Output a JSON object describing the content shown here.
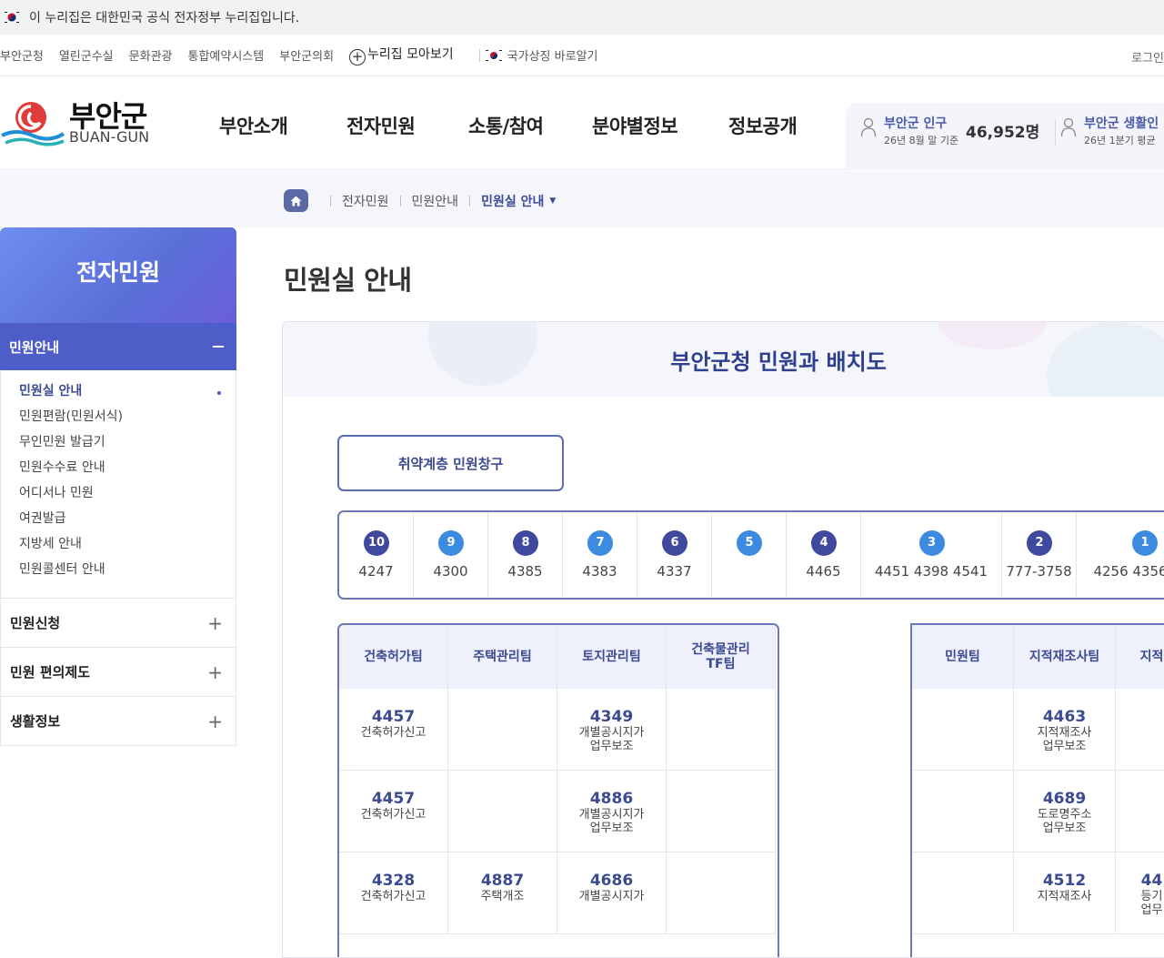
{
  "gov_banner": {
    "text": "이 누리집은 대한민국 공식 전자정부 누리집입니다."
  },
  "util_links": [
    "부안군청",
    "열린군수실",
    "문화관광",
    "통합예약시스템",
    "부안군의회"
  ],
  "util_gather": "누리집 모아보기",
  "util_symbol": "국가상징 바로알기",
  "util_login": "로그인",
  "logo": {
    "name": "부안군",
    "en": "BUAN-GUN"
  },
  "gnb": [
    "부안소개",
    "전자민원",
    "소통/참여",
    "분야별정보",
    "정보공개"
  ],
  "stats": [
    {
      "title": "부안군 인구",
      "sub": "26년 8월 말 기준",
      "value": "46,952명"
    },
    {
      "title": "부안군 생활인",
      "sub": "26년 1분기 평균",
      "value": ""
    }
  ],
  "breadcrumb": [
    "전자민원",
    "민원안내",
    "민원실 안내"
  ],
  "sidebar": {
    "title": "전자민원",
    "open_section": "민원안내",
    "sub_items": [
      "민원실 안내",
      "민원편람(민원서식)",
      "무인민원 발급기",
      "민원수수료 안내",
      "어디서나 민원",
      "여권발급",
      "지방세 안내",
      "민원콜센터 안내"
    ],
    "sections": [
      "민원신청",
      "민원 편의제도",
      "생활정보"
    ]
  },
  "page_title": "민원실 안내",
  "map_title": "부안군청 민원과 배치도",
  "weak_window_button": "취약계층 민원창구",
  "windows": [
    {
      "no": "10",
      "nums": "4247"
    },
    {
      "no": "9",
      "nums": "4300"
    },
    {
      "no": "8",
      "nums": "4385"
    },
    {
      "no": "7",
      "nums": "4383"
    },
    {
      "no": "6",
      "nums": "4337"
    },
    {
      "no": "5",
      "nums": ""
    },
    {
      "no": "4",
      "nums": "4465"
    },
    {
      "no": "3",
      "nums": "4451  4398  4541"
    },
    {
      "no": "2",
      "nums": "777-3758"
    },
    {
      "no": "1",
      "nums": "4256  4356"
    }
  ],
  "badge_colors": {
    "navy": "#3f4a9e",
    "blue": "#3d8be0"
  },
  "table_left": {
    "headers": [
      "건축허가팀",
      "주택관리팀",
      "토지관리팀",
      "건축물관리\nTF팀"
    ],
    "rows": [
      [
        {
          "ext": "4457",
          "job": "건축허가신고"
        },
        {
          "ext": "",
          "job": ""
        },
        {
          "ext": "4349",
          "job": "개별공시지가\n업무보조"
        },
        {
          "ext": "",
          "job": ""
        }
      ],
      [
        {
          "ext": "4457",
          "job": "건축허가신고"
        },
        {
          "ext": "",
          "job": ""
        },
        {
          "ext": "4886",
          "job": "개별공시지가\n업무보조"
        },
        {
          "ext": "",
          "job": ""
        }
      ],
      [
        {
          "ext": "4328",
          "job": "건축허가신고"
        },
        {
          "ext": "4887",
          "job": "주택개조"
        },
        {
          "ext": "4686",
          "job": "개별공시지가"
        },
        {
          "ext": "",
          "job": ""
        }
      ]
    ]
  },
  "table_right": {
    "headers": [
      "민원팀",
      "지적재조사팀",
      "지적"
    ],
    "rows": [
      [
        {
          "ext": "",
          "job": ""
        },
        {
          "ext": "4463",
          "job": "지적재조사\n업무보조"
        },
        {
          "ext": "",
          "job": ""
        }
      ],
      [
        {
          "ext": "",
          "job": ""
        },
        {
          "ext": "4689",
          "job": "도로명주소\n업무보조"
        },
        {
          "ext": "",
          "job": ""
        }
      ],
      [
        {
          "ext": "",
          "job": ""
        },
        {
          "ext": "4512",
          "job": "지적재조사"
        },
        {
          "ext": "44",
          "job": "등기\n업무"
        }
      ]
    ]
  }
}
